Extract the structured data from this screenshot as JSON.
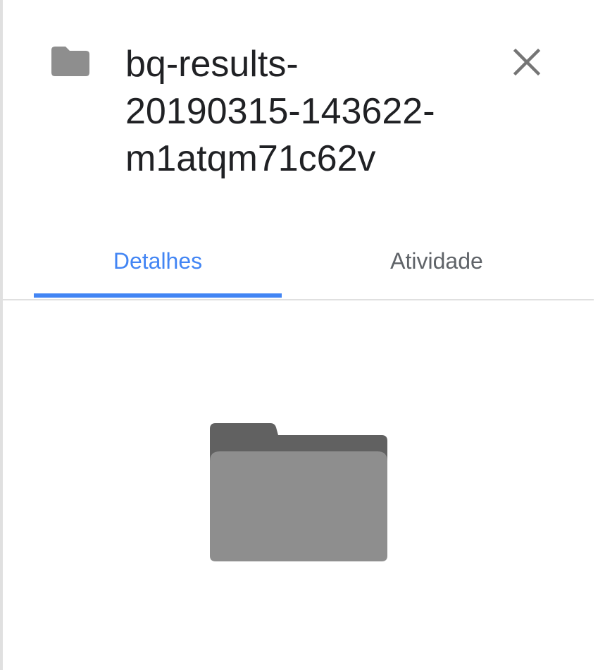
{
  "file": {
    "name": "bq-results-\n20190315-143622-\nm1atqm71c62v",
    "type_icon": "folder-icon"
  },
  "header": {
    "close_icon": "close-icon"
  },
  "tabs": [
    {
      "label": "Detalhes",
      "active": true
    },
    {
      "label": "Atividade",
      "active": false
    }
  ],
  "colors": {
    "accent": "#4285f4",
    "title": "#202124",
    "inactive_tab": "#5f6368",
    "folder_back": "#616161",
    "folder_front": "#8e8e8e",
    "divider": "#e0e0e0"
  },
  "preview": {
    "icon": "folder-icon"
  }
}
